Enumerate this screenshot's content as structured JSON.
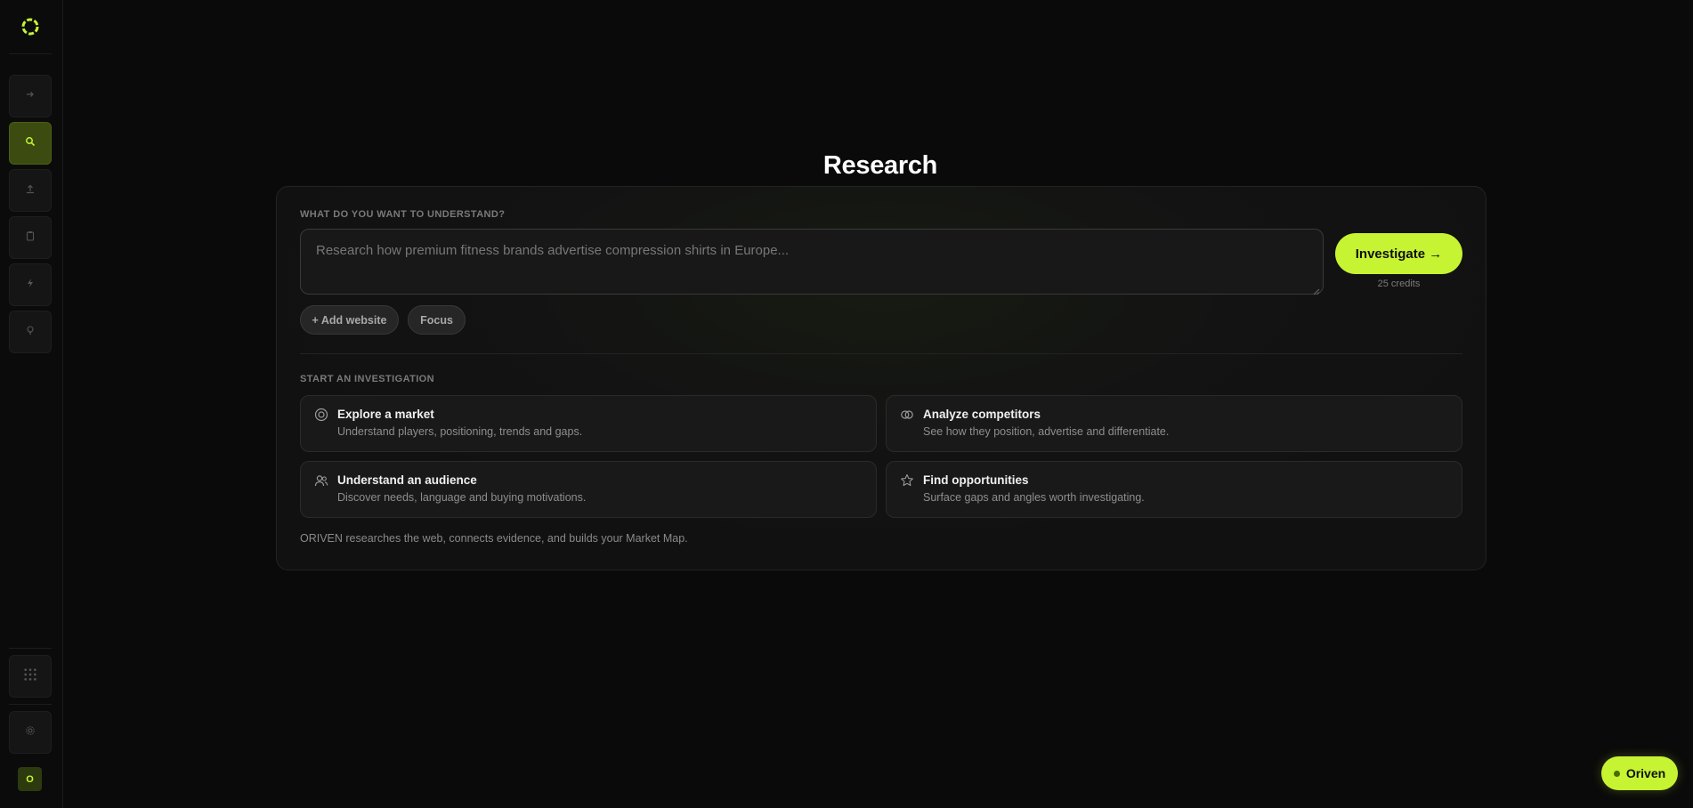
{
  "sidebar": {
    "logo": "oriven-logo-icon",
    "nav": [
      {
        "name": "collapse-arrow-icon",
        "active": false
      },
      {
        "name": "search-icon",
        "active": true
      },
      {
        "name": "upload-icon",
        "active": false
      },
      {
        "name": "clipboard-icon",
        "active": false
      },
      {
        "name": "bolt-icon",
        "active": false
      },
      {
        "name": "lightbulb-icon",
        "active": false
      }
    ],
    "bottom": [
      {
        "name": "apps-grid-icon"
      },
      {
        "name": "settings-icon"
      }
    ],
    "avatar_initial": "O"
  },
  "page": {
    "title": "Research"
  },
  "research": {
    "prompt_label": "WHAT DO YOU WANT TO UNDERSTAND?",
    "prompt_placeholder": "Research how premium fitness brands advertise compression shirts in Europe...",
    "prompt_value": "",
    "investigate_label": "Investigate →",
    "credits": "25 credits",
    "add_website_label": "+ Add website",
    "focus_label": "Focus",
    "start_label": "START AN INVESTIGATION",
    "options": [
      {
        "icon": "target-icon",
        "title": "Explore a market",
        "desc": "Understand players, positioning, trends and gaps."
      },
      {
        "icon": "overlapping-circles-icon",
        "title": "Analyze competitors",
        "desc": "See how they position, advertise and differentiate."
      },
      {
        "icon": "users-icon",
        "title": "Understand an audience",
        "desc": "Discover needs, language and buying motivations."
      },
      {
        "icon": "star-icon",
        "title": "Find opportunities",
        "desc": "Surface gaps and angles worth investigating."
      }
    ],
    "footer_note": "ORIVEN researches the web, connects evidence, and builds your Market Map."
  },
  "assistant": {
    "label": "Oriven"
  },
  "colors": {
    "accent": "#c6f432",
    "background": "#0a0a0a",
    "card": "#131313"
  }
}
